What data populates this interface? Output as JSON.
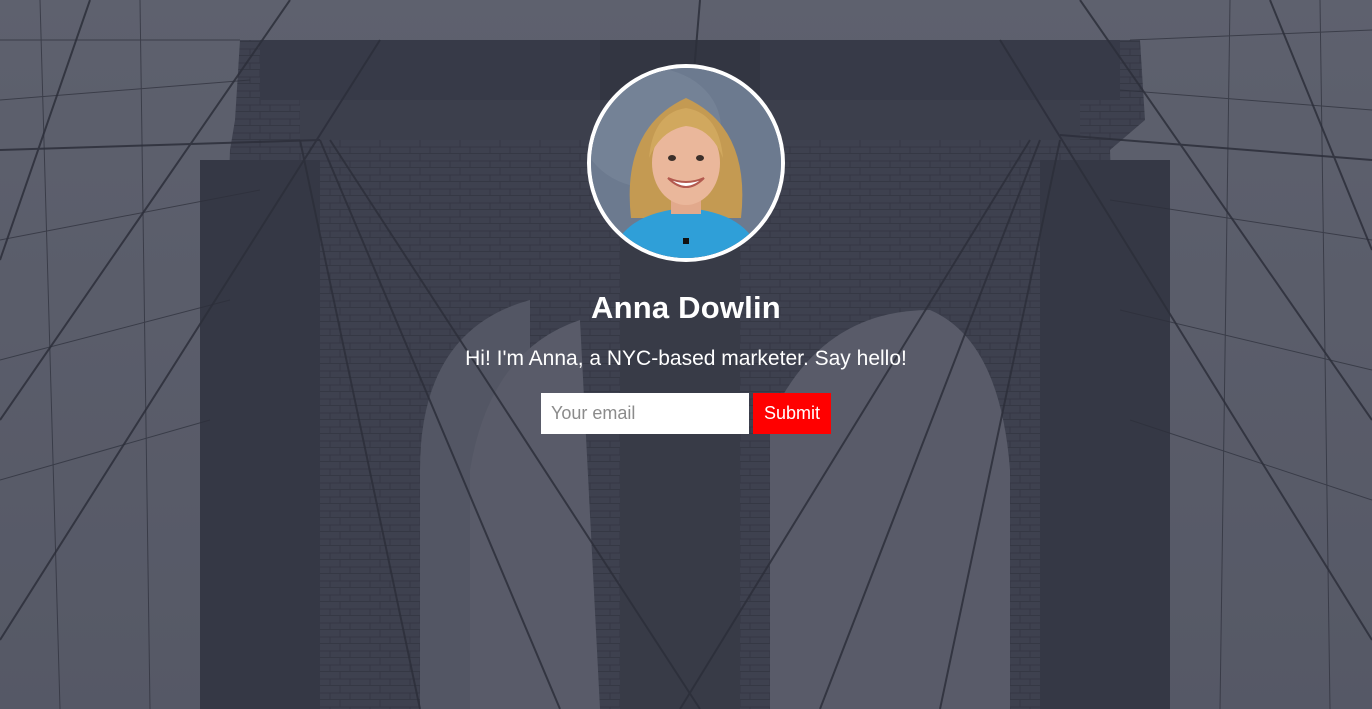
{
  "profile": {
    "name": "Anna Dowlin",
    "tagline": "Hi! I'm Anna, a NYC-based marketer. Say hello!",
    "avatar_alt": "profile-photo"
  },
  "signup": {
    "email_placeholder": "Your email",
    "email_value": "",
    "submit_label": "Submit"
  },
  "colors": {
    "submit_bg": "#ff0000",
    "text": "#ffffff",
    "avatar_border": "#ffffff"
  }
}
